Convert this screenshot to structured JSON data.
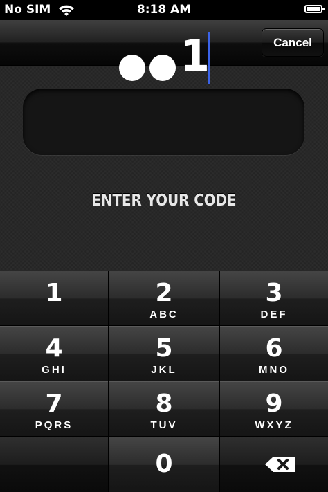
{
  "status_bar": {
    "carrier": "No SIM",
    "time": "8:18 AM"
  },
  "nav": {
    "cancel_label": "Cancel"
  },
  "code_entry": {
    "masked_count": 2,
    "last_digit": "1",
    "prompt": "ENTER YOUR CODE",
    "cursor_color": "#3b63e8"
  },
  "keypad": {
    "keys": [
      {
        "num": "1",
        "letters": ""
      },
      {
        "num": "2",
        "letters": "ABC"
      },
      {
        "num": "3",
        "letters": "DEF"
      },
      {
        "num": "4",
        "letters": "GHI"
      },
      {
        "num": "5",
        "letters": "JKL"
      },
      {
        "num": "6",
        "letters": "MNO"
      },
      {
        "num": "7",
        "letters": "PQRS"
      },
      {
        "num": "8",
        "letters": "TUV"
      },
      {
        "num": "9",
        "letters": "WXYZ"
      },
      {
        "num": "0",
        "letters": ""
      }
    ],
    "delete_icon": "backspace-icon"
  }
}
